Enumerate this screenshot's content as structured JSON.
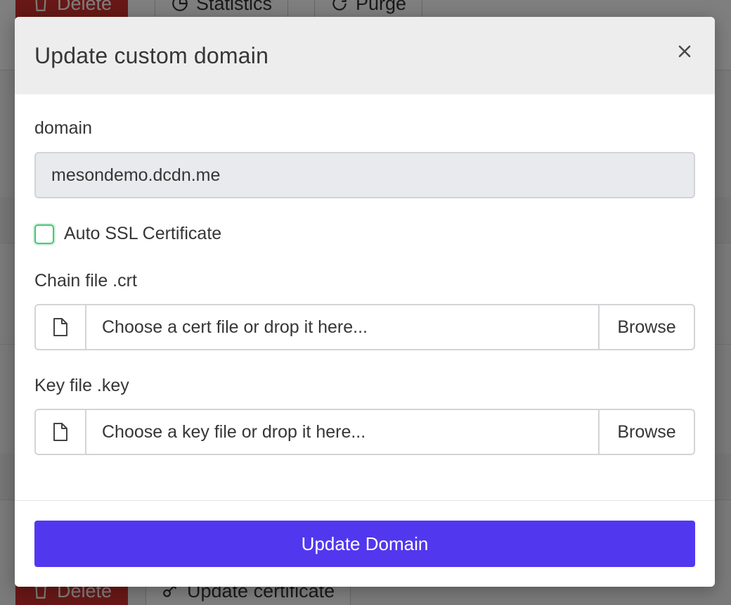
{
  "background": {
    "top_buttons": {
      "delete": "Delete",
      "statistics": "Statistics",
      "purge": "Purge"
    },
    "bottom_buttons": {
      "delete": "Delete",
      "update_certificate": "Update certificate"
    }
  },
  "modal": {
    "title": "Update custom domain",
    "close_icon": "close-icon",
    "domain": {
      "label": "domain",
      "value": "mesondemo.dcdn.me"
    },
    "auto_ssl": {
      "label": "Auto SSL Certificate",
      "checked": false
    },
    "chain_file": {
      "label": "Chain file .crt",
      "placeholder": "Choose a cert file or drop it here...",
      "browse": "Browse",
      "icon": "file-icon"
    },
    "key_file": {
      "label": "Key file .key",
      "placeholder": "Choose a key file or drop it here...",
      "browse": "Browse",
      "icon": "file-icon"
    },
    "submit_label": "Update Domain"
  },
  "colors": {
    "primary": "#5138ee",
    "checkbox_border": "#48c774",
    "danger": "#d0312d",
    "header_bg": "#ededed"
  }
}
